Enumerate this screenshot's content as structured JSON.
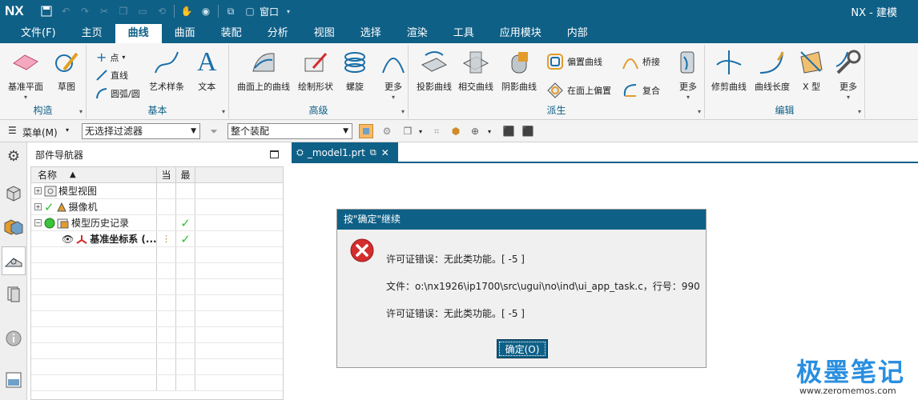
{
  "titlebar": {
    "logo": "NX",
    "window_menu": "窗口",
    "app_title": "NX - 建模"
  },
  "menu": [
    "文件(F)",
    "主页",
    "曲线",
    "曲面",
    "装配",
    "分析",
    "视图",
    "选择",
    "渲染",
    "工具",
    "应用模块",
    "内部"
  ],
  "ribbon": {
    "groups": {
      "construct": "构造",
      "basic": "基本",
      "advanced": "高级",
      "derived": "派生",
      "edit": "编辑"
    },
    "datum_plane": "基准平面",
    "sketch": "草图",
    "point": "点",
    "line": "直线",
    "arc_circle": "圆弧/圆",
    "art_spline": "艺术样条",
    "text": "文本",
    "curve_on_surface": "曲面上的曲线",
    "draw_shape": "绘制形状",
    "helix": "螺旋",
    "more": "更多",
    "project_curve": "投影曲线",
    "intersect_curve": "相交曲线",
    "shadow_curve": "阴影曲线",
    "offset_curve": "偏置曲线",
    "offset_on_face": "在面上偏置",
    "bridge": "桥接",
    "composite": "复合",
    "trim_curve": "修剪曲线",
    "curve_length": "曲线长度",
    "x_type": "X 型"
  },
  "toolbar2": {
    "menu_label": "菜单(M)",
    "filter": "无选择过滤器",
    "assembly": "整个装配"
  },
  "navigator": {
    "title": "部件导航器",
    "columns": {
      "name": "名称",
      "current": "当",
      "latest": "最"
    },
    "rows": {
      "model_views": "模型视图",
      "cameras": "摄像机",
      "history": "模型历史记录",
      "datum_csys": "基准坐标系 (..."
    }
  },
  "doc_tab": "_model1.prt",
  "dialog": {
    "title": "按\"确定\"继续",
    "line1": "许可证错误：无此类功能。[ -5 ]",
    "line2": "文件：o:\\nx1926\\ip1700\\src\\ugui\\no\\ind\\ui_app_task.c，行号：990",
    "line3": "许可证错误：无此类功能。[ -5 ]",
    "ok": "确定(O)"
  },
  "watermark": {
    "text": "极墨笔记",
    "url": "www.zeromemos.com"
  },
  "colors": {
    "accent": "#0f6087",
    "check": "#2ec02e",
    "error": "#d32d2d"
  }
}
